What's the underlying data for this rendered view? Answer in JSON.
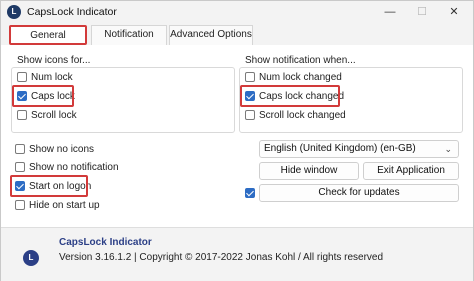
{
  "window": {
    "title": "CapsLock Indicator",
    "app_icon_glyph": "L",
    "controls": {
      "minimize": "—",
      "maximize": "☐",
      "close": "✕"
    }
  },
  "tabs": [
    {
      "label": "General",
      "active": true,
      "highlighted": true
    },
    {
      "label": "Notification",
      "active": false
    },
    {
      "label": "Advanced Options",
      "active": false
    }
  ],
  "show_icons": {
    "title": "Show icons for...",
    "items": [
      {
        "label": "Num lock",
        "checked": false
      },
      {
        "label": "Caps lock",
        "checked": true,
        "highlighted": true
      },
      {
        "label": "Scroll lock",
        "checked": false
      }
    ]
  },
  "show_notification": {
    "title": "Show notification when...",
    "items": [
      {
        "label": "Num lock changed",
        "checked": false
      },
      {
        "label": "Caps lock changed",
        "checked": true,
        "highlighted": true
      },
      {
        "label": "Scroll lock changed",
        "checked": false
      }
    ]
  },
  "options": [
    {
      "label": "Show no icons",
      "checked": false
    },
    {
      "label": "Show no notification",
      "checked": false
    },
    {
      "label": "Start on logon",
      "checked": true,
      "highlighted": true
    },
    {
      "label": "Hide on start up",
      "checked": false
    }
  ],
  "language": {
    "selected": "English (United Kingdom) (en-GB)",
    "chevron": "⌄"
  },
  "buttons": {
    "hide_window": "Hide window",
    "exit_application": "Exit Application",
    "check_updates": "Check for updates"
  },
  "check_updates_checkbox": {
    "checked": true
  },
  "footer": {
    "logo_glyph": "L",
    "title": "CapsLock Indicator",
    "version": "Version 3.16.1.2 | Copyright © 2017-2022 Jonas Kohl / All rights reserved"
  },
  "colors": {
    "accent": "#2d6cc4",
    "highlight": "#d23a3a",
    "footer_title": "#2b3f86"
  }
}
